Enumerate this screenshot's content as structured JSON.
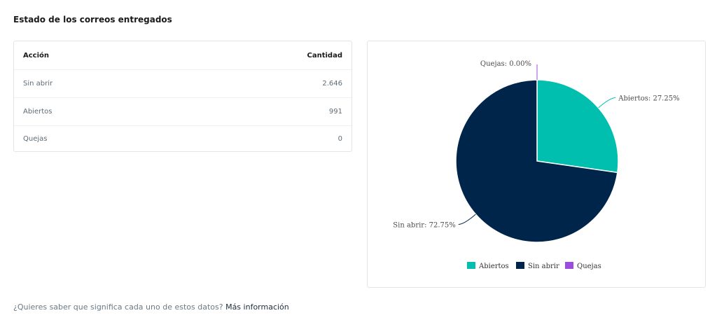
{
  "section": {
    "title": "Estado de los correos entregados"
  },
  "table": {
    "headers": {
      "action": "Acción",
      "quantity": "Cantidad"
    },
    "rows": [
      {
        "label": "Sin abrir",
        "value": "2.646"
      },
      {
        "label": "Abiertos",
        "value": "991"
      },
      {
        "label": "Quejas",
        "value": "0"
      }
    ]
  },
  "chart_data": {
    "type": "pie",
    "slices": [
      {
        "name": "Abiertos",
        "value": 27.25,
        "label": "Abiertos: 27.25%",
        "color": "#00bfae"
      },
      {
        "name": "Sin abrir",
        "value": 72.75,
        "label": "Sin abrir: 72.75%",
        "color": "#00254a"
      },
      {
        "name": "Quejas",
        "value": 0.0,
        "label": "Quejas: 0.00%",
        "color": "#9b4dde"
      }
    ],
    "legend": [
      "Abiertos",
      "Sin abrir",
      "Quejas"
    ],
    "legend_position": "bottom"
  },
  "footer": {
    "question": "¿Quieres saber que significa cada uno de estos datos?",
    "link": "Más información"
  }
}
